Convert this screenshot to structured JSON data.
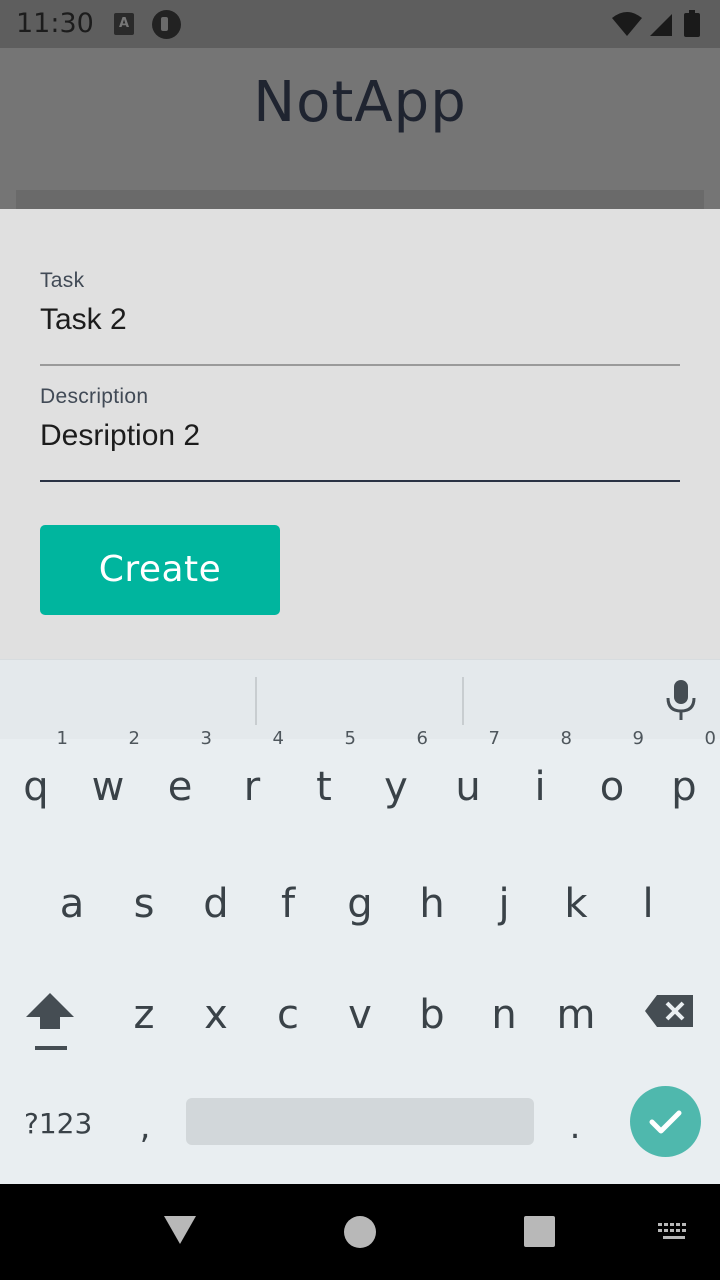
{
  "status_bar": {
    "time": "11:30",
    "icons": [
      "accessibility-a-icon",
      "pocketcasts-icon",
      "wifi-icon",
      "signal-icon",
      "battery-icon"
    ]
  },
  "app": {
    "title": "NotApp"
  },
  "form": {
    "task": {
      "label": "Task",
      "value": "Task 2"
    },
    "description": {
      "label": "Description",
      "value": "Desription 2"
    },
    "create_label": "Create"
  },
  "keyboard": {
    "row1": [
      {
        "key": "q",
        "hint": "1"
      },
      {
        "key": "w",
        "hint": "2"
      },
      {
        "key": "e",
        "hint": "3"
      },
      {
        "key": "r",
        "hint": "4"
      },
      {
        "key": "t",
        "hint": "5"
      },
      {
        "key": "y",
        "hint": "6"
      },
      {
        "key": "u",
        "hint": "7"
      },
      {
        "key": "i",
        "hint": "8"
      },
      {
        "key": "o",
        "hint": "9"
      },
      {
        "key": "p",
        "hint": "0"
      }
    ],
    "row2": [
      "a",
      "s",
      "d",
      "f",
      "g",
      "h",
      "j",
      "k",
      "l"
    ],
    "row3": [
      "z",
      "x",
      "c",
      "v",
      "b",
      "n",
      "m"
    ],
    "symbols_label": "?123",
    "comma": ",",
    "period": ".",
    "enter_color": "#4fb8ad"
  },
  "colors": {
    "accent": "#00b59e",
    "title": "#1f2430"
  }
}
